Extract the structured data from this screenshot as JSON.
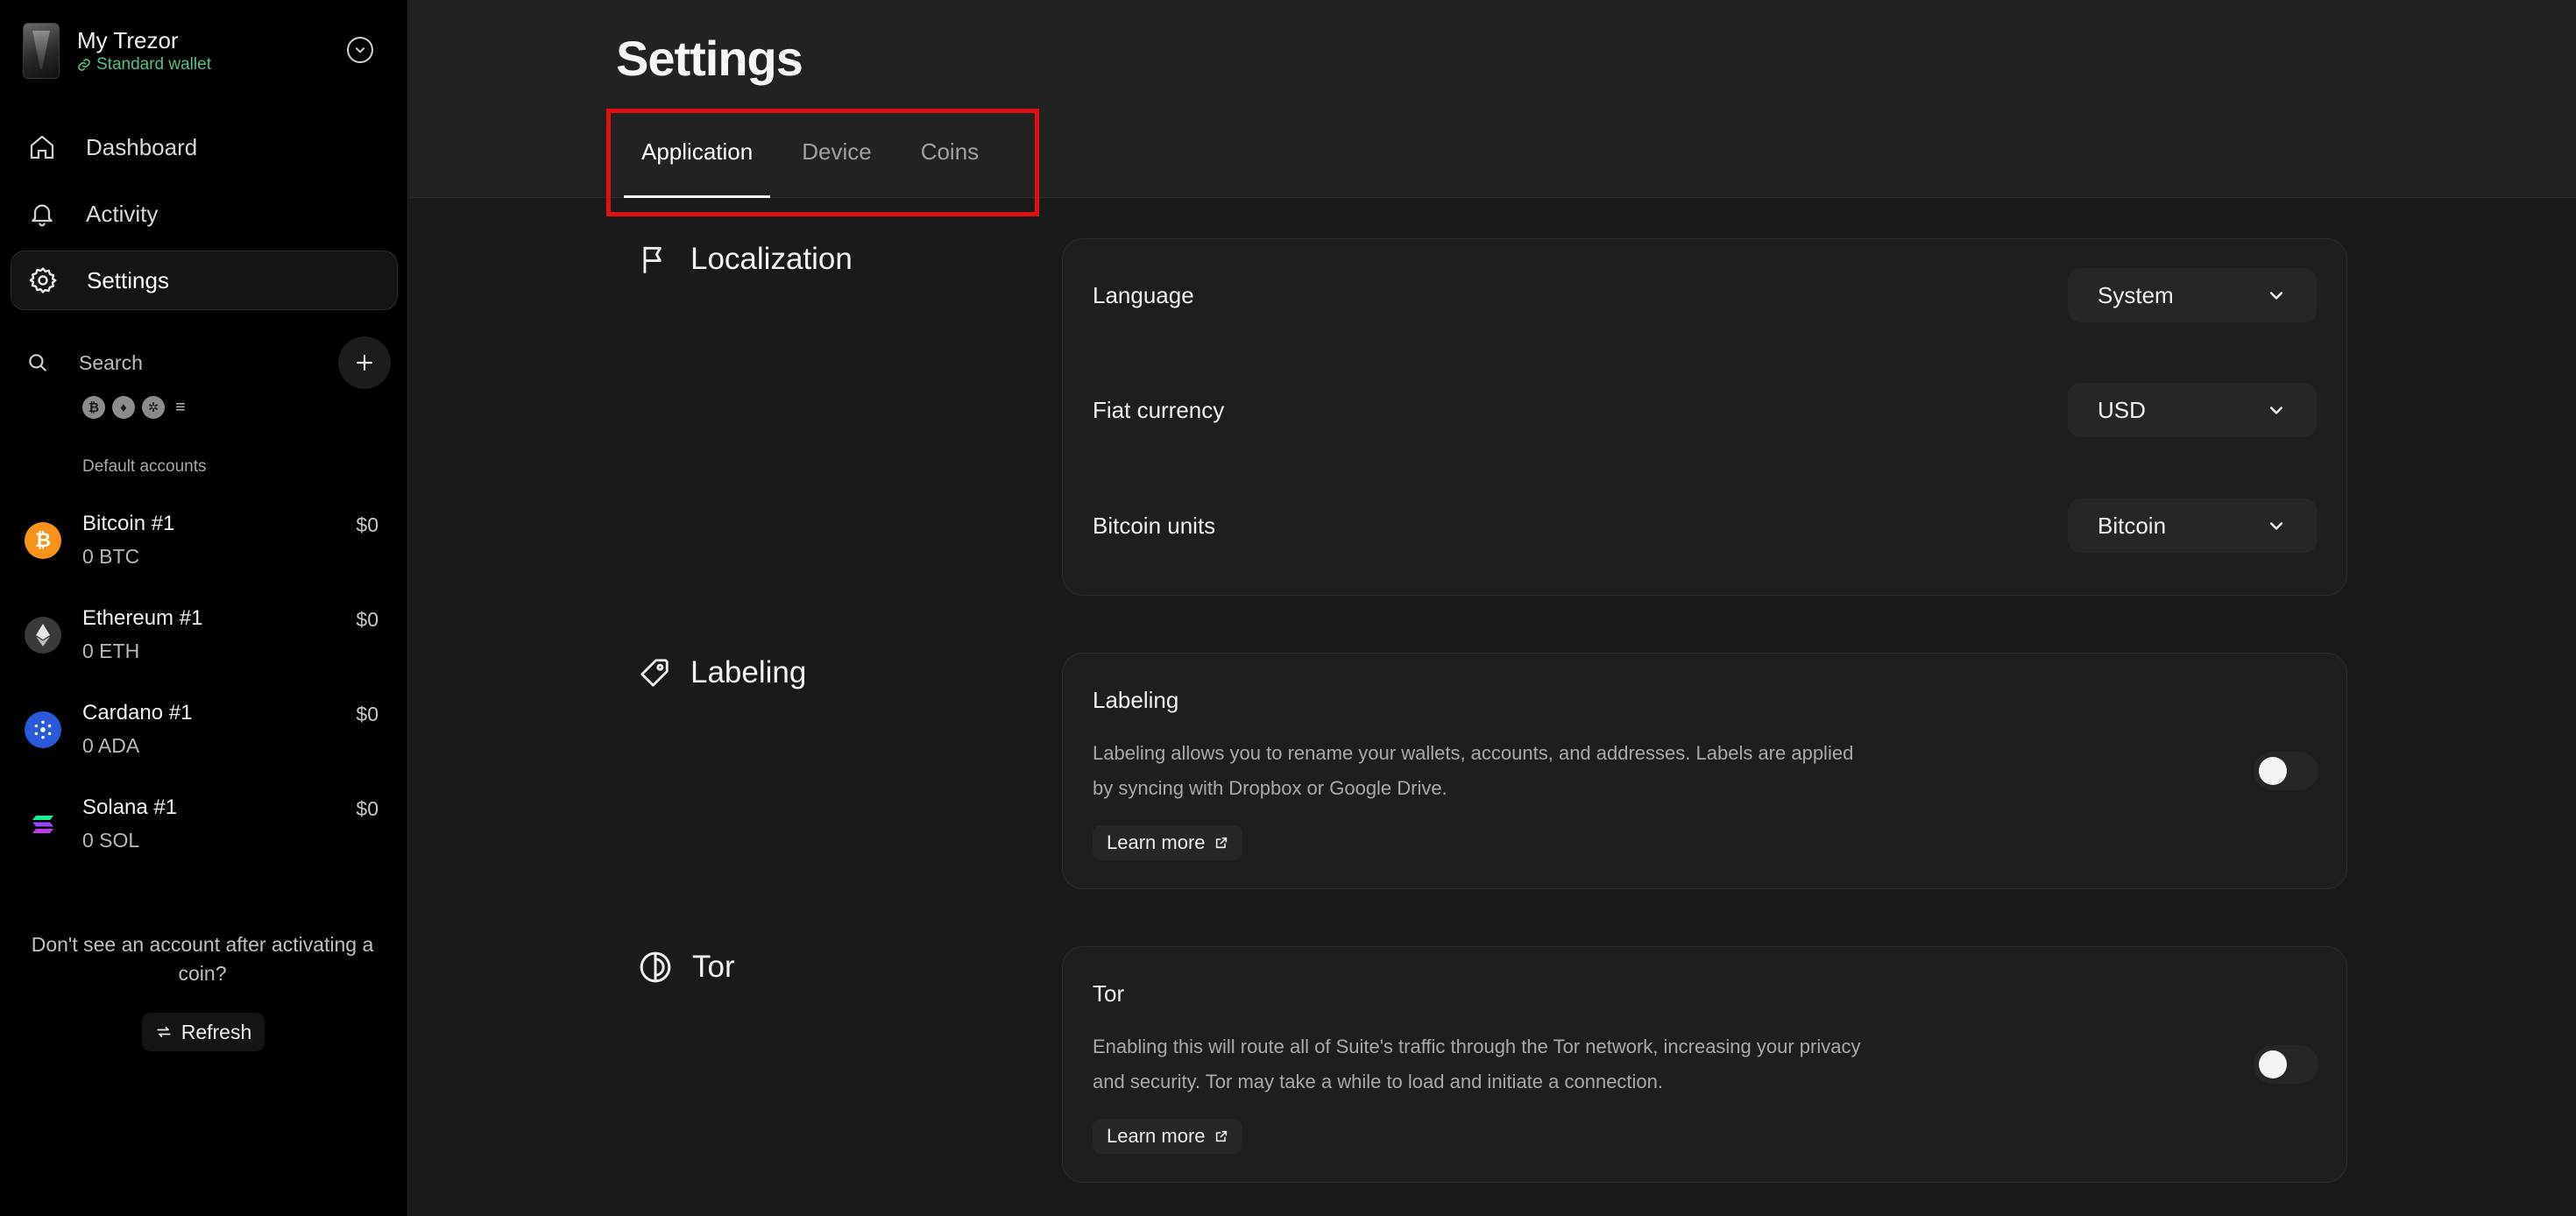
{
  "sidebar": {
    "wallet": {
      "name": "My Trezor",
      "type": "Standard wallet"
    },
    "nav": [
      {
        "label": "Dashboard",
        "icon": "home-icon"
      },
      {
        "label": "Activity",
        "icon": "bell-icon"
      },
      {
        "label": "Settings",
        "icon": "gear-icon",
        "active": true
      }
    ],
    "search_label": "Search",
    "coin_filters": [
      "bitcoin-filter-icon",
      "ethereum-filter-icon",
      "cardano-filter-icon",
      "solana-filter-icon"
    ],
    "accounts_section": "Default accounts",
    "accounts": [
      {
        "name": "Bitcoin #1",
        "balance": "0 BTC",
        "fiat": "$0",
        "icon": "bitcoin-icon",
        "color": "#f7931a"
      },
      {
        "name": "Ethereum #1",
        "balance": "0 ETH",
        "fiat": "$0",
        "icon": "ethereum-icon",
        "color": "#3c3c3d"
      },
      {
        "name": "Cardano #1",
        "balance": "0 ADA",
        "fiat": "$0",
        "icon": "cardano-icon",
        "color": "#2a5ada"
      },
      {
        "name": "Solana #1",
        "balance": "0 SOL",
        "fiat": "$0",
        "icon": "solana-icon",
        "color": "#1b1b1b"
      }
    ],
    "missing_text": "Don't see an account after activating a coin?",
    "refresh_label": "Refresh"
  },
  "page": {
    "title": "Settings",
    "tabs": [
      {
        "label": "Application",
        "active": true
      },
      {
        "label": "Device",
        "active": false
      },
      {
        "label": "Coins",
        "active": false
      }
    ]
  },
  "localization": {
    "heading": "Localization",
    "rows": [
      {
        "label": "Language",
        "value": "System"
      },
      {
        "label": "Fiat currency",
        "value": "USD"
      },
      {
        "label": "Bitcoin units",
        "value": "Bitcoin"
      }
    ]
  },
  "labeling": {
    "heading": "Labeling",
    "title": "Labeling",
    "description": "Labeling allows you to rename your wallets, accounts, and addresses. Labels are applied by syncing with Dropbox or Google Drive.",
    "learn_more": "Learn more",
    "enabled": false
  },
  "tor": {
    "heading": "Tor",
    "title": "Tor",
    "description": "Enabling this will route all of Suite's traffic through the Tor network, increasing your privacy and security. Tor may take a while to load and initiate a connection.",
    "learn_more": "Learn more",
    "enabled": false
  },
  "colors": {
    "accent_green": "#4fc38a",
    "highlight_red": "#e01010",
    "background": "#1a1a1a",
    "sidebar": "#000000"
  }
}
